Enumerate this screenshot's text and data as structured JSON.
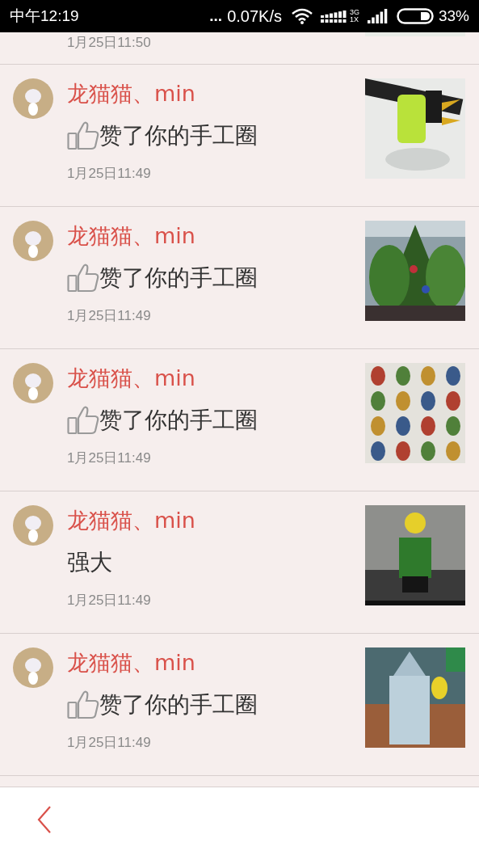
{
  "status_bar": {
    "time": "中午12:19",
    "more": "...",
    "speed": "0.07K/s",
    "network_top": "3G",
    "network_bottom": "1X",
    "battery": "33%"
  },
  "partial_top_item": {
    "time": "1月25日11:50"
  },
  "notifications": [
    {
      "name": "龙猫猫、min",
      "kind": "like",
      "message": "赞了你的手工圈",
      "time": "1月25日11:49"
    },
    {
      "name": "龙猫猫、min",
      "kind": "like",
      "message": "赞了你的手工圈",
      "time": "1月25日11:49"
    },
    {
      "name": "龙猫猫、min",
      "kind": "like",
      "message": "赞了你的手工圈",
      "time": "1月25日11:49"
    },
    {
      "name": "龙猫猫、min",
      "kind": "comment",
      "message": "强大",
      "time": "1月25日11:49"
    },
    {
      "name": "龙猫猫、min",
      "kind": "like",
      "message": "赞了你的手工圈",
      "time": "1月25日11:49"
    }
  ]
}
